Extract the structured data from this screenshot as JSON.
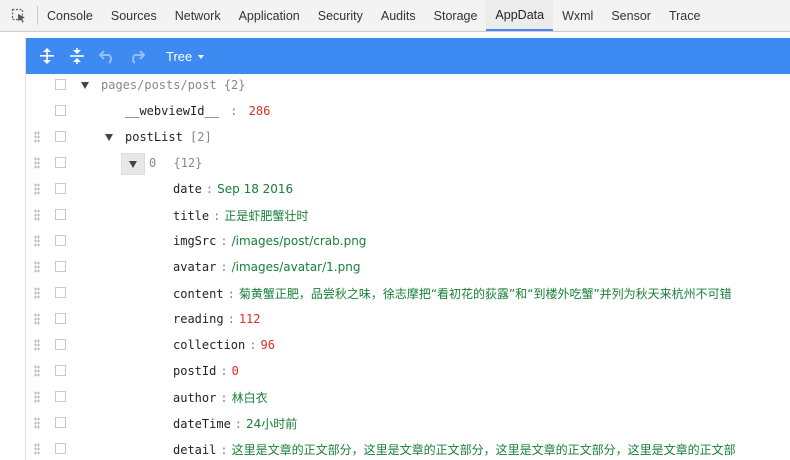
{
  "tabs": [
    "Console",
    "Sources",
    "Network",
    "Application",
    "Security",
    "Audits",
    "Storage",
    "AppData",
    "Wxml",
    "Sensor",
    "Trace"
  ],
  "active_tab": "AppData",
  "toolbar": {
    "mode_label": "Tree"
  },
  "tree": {
    "root": {
      "key": "pages/posts/post",
      "meta": "{2}"
    },
    "webview": {
      "key": "__webviewId__",
      "value": "286"
    },
    "postList": {
      "key": "postList",
      "meta": "[2]"
    },
    "item0": {
      "key": "0",
      "meta": "{12}"
    },
    "fields": [
      {
        "key": "date",
        "value": "Sep 18 2016",
        "type": "string"
      },
      {
        "key": "title",
        "value": "正是虾肥蟹壮时",
        "type": "string"
      },
      {
        "key": "imgSrc",
        "value": "/images/post/crab.png",
        "type": "string"
      },
      {
        "key": "avatar",
        "value": "/images/avatar/1.png",
        "type": "string"
      },
      {
        "key": "content",
        "value": "菊黄蟹正肥，品尝秋之味，徐志摩把“看初花的荻露”和“到楼外吃蟹”并列为秋天来杭州不可错",
        "type": "string"
      },
      {
        "key": "reading",
        "value": "112",
        "type": "number"
      },
      {
        "key": "collection",
        "value": "96",
        "type": "number"
      },
      {
        "key": "postId",
        "value": "0",
        "type": "number"
      },
      {
        "key": "author",
        "value": "林白衣",
        "type": "string"
      },
      {
        "key": "dateTime",
        "value": "24小时前",
        "type": "string"
      },
      {
        "key": "detail",
        "value": "这里是文章的正文部分，这里是文章的正文部分，这里是文章的正文部分，这里是文章的正文部",
        "type": "string"
      }
    ],
    "separator": ":"
  }
}
